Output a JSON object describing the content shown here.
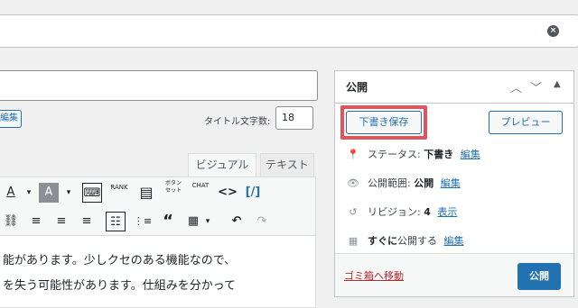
{
  "title_field": {
    "value": "",
    "clear_icon": "x-circle-icon"
  },
  "editor": {
    "edit_button": "編集",
    "title_count_label": "タイトル文字数:",
    "title_count": "18",
    "tabs": [
      "ビジュアル",
      "テキスト"
    ],
    "toolbar_row1": [
      "A",
      "▾",
      "A",
      "▾",
      "⌨",
      "RANK",
      "▤",
      "ボタンセット",
      "CHAT",
      "<>",
      "[/]"
    ],
    "toolbar_row2": [
      "⛓",
      "≡",
      "≡",
      "≡",
      "☷",
      "⋮≡",
      "“",
      "▦",
      "▾",
      "↶",
      "↷"
    ],
    "content_lines": [
      "能があります。少しクセのある機能なので、",
      "を失う可能性があります。仕組みを分かって"
    ]
  },
  "publish": {
    "title": "公開",
    "save_draft": "下書き保存",
    "preview": "プレビュー",
    "status_label": "ステータス:",
    "status_value": "下書き",
    "status_edit": "編集",
    "visibility_label": "公開範囲:",
    "visibility_value": "公開",
    "visibility_edit": "編集",
    "revisions_label": "リビジョン:",
    "revisions_value": "4",
    "revisions_link": "表示",
    "schedule_value": "すぐに",
    "schedule_label": "公開する",
    "schedule_edit": "編集",
    "trash": "ゴミ箱へ移動",
    "publish_button": "公開"
  },
  "colors": {
    "accent": "#2271b1",
    "highlight": "#e4525d",
    "danger": "#b32d2e"
  }
}
